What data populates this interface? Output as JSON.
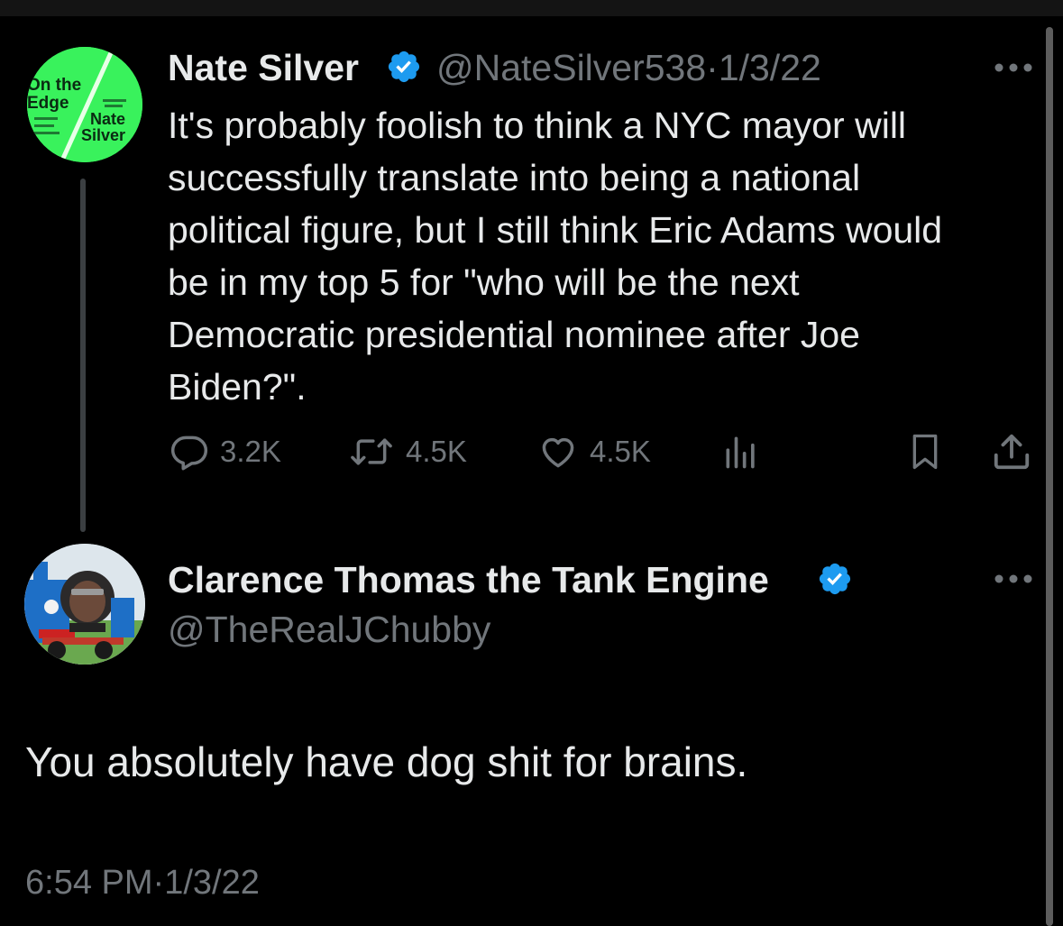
{
  "colors": {
    "background": "#000000",
    "text": "#e7e9ea",
    "muted": "#71767b",
    "verified": "#1d9bf0",
    "avatar_green": "#39f25c"
  },
  "parent_tweet": {
    "author_name": "Nate Silver",
    "handle": "@NateSilver538",
    "separator": "·",
    "date": "1/3/22",
    "avatar_text": {
      "line1": "On the",
      "line2": "Edge",
      "line3": "Nate",
      "line4": "Silver"
    },
    "text_lines": [
      "It's probably foolish to think a NYC mayor will",
      "successfully translate into being a national",
      "political figure, but I still think Eric Adams would",
      "be in my top 5 for \"who will be the next",
      "Democratic presidential nominee after Joe",
      "Biden?\"."
    ],
    "actions": {
      "replies": "3.2K",
      "reposts": "4.5K",
      "likes": "4.5K"
    },
    "icons": [
      "verified-badge-icon",
      "more-icon",
      "reply-icon",
      "repost-icon",
      "like-icon",
      "views-icon",
      "bookmark-icon",
      "share-icon"
    ]
  },
  "reply_tweet": {
    "author_name": "Clarence Thomas the Tank Engine",
    "handle": "@TheRealJChubby",
    "text": "You absolutely have dog shit for brains.",
    "time": "6:54 PM",
    "separator": "·",
    "date": "1/3/22"
  }
}
